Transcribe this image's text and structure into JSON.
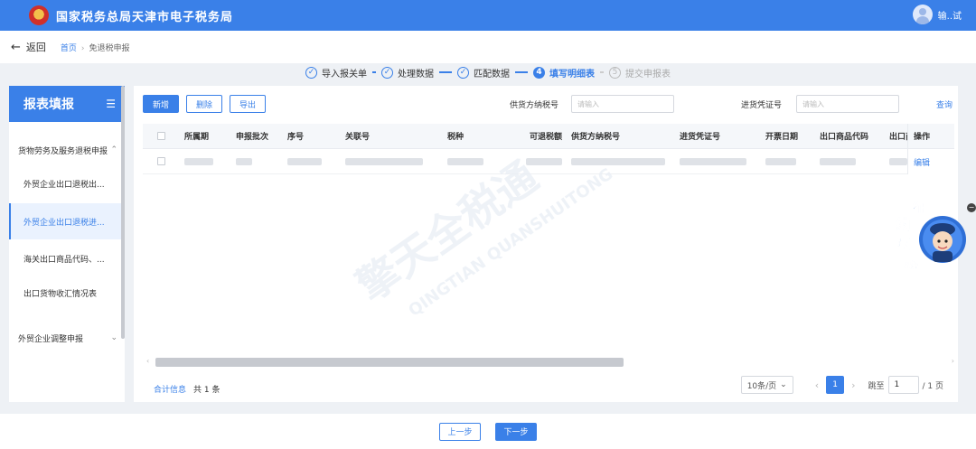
{
  "header": {
    "title": "国家税务总局天津市电子税务局",
    "user_name": "输..试"
  },
  "nav": {
    "back_label": "返回",
    "breadcrumb_home": "首页",
    "breadcrumb_sep": "›",
    "breadcrumb_current": "免退税申报"
  },
  "steps": [
    {
      "num": "✓",
      "label": "导入报关单"
    },
    {
      "num": "✓",
      "label": "处理数据"
    },
    {
      "num": "✓",
      "label": "匹配数据"
    },
    {
      "num": "4",
      "label": "填写明细表"
    },
    {
      "num": "5",
      "label": "提交申报表"
    }
  ],
  "sidebar": {
    "title": "报表填报",
    "groups": [
      {
        "label": "货物劳务及服务退税申报"
      },
      {
        "label": "外贸企业调整申报"
      }
    ],
    "items": [
      {
        "label": "外贸企业出口退税出..."
      },
      {
        "label": "外贸企业出口退税进..."
      },
      {
        "label": "海关出口商品代码、..."
      },
      {
        "label": "出口货物收汇情况表"
      }
    ]
  },
  "toolbar": {
    "add_label": "新增",
    "delete_label": "删除",
    "export_label": "导出"
  },
  "filters": {
    "supplier_tax_id_label": "供货方纳税号",
    "supplier_tax_id_placeholder": "请输入",
    "invoice_label": "进货凭证号",
    "invoice_placeholder": "请输入",
    "query_label": "查询"
  },
  "table": {
    "columns": [
      "所属期",
      "申报批次",
      "序号",
      "关联号",
      "税种",
      "可退税额",
      "供货方纳税号",
      "进货凭证号",
      "开票日期",
      "出口商品代码",
      "出口商",
      "操作"
    ],
    "row_action": "编辑"
  },
  "footer": {
    "summary_link": "合计信息",
    "total_text": "共 1 条",
    "page_size": "10条/页",
    "current_page": "1",
    "jump_label": "跳至",
    "jump_value": "1",
    "page_total": "/ 1 页"
  },
  "actions": {
    "prev_label": "上一步",
    "next_label": "下一步"
  },
  "mascot": {
    "chars": [
      "纳",
      "征",
      "互",
      "动"
    ]
  },
  "watermark": {
    "cn": "擎天全税通",
    "en": "QINGTIAN QUANSHUITONG"
  },
  "colors": {
    "primary": "#3a80e8",
    "page_bg": "#eef1f5"
  }
}
